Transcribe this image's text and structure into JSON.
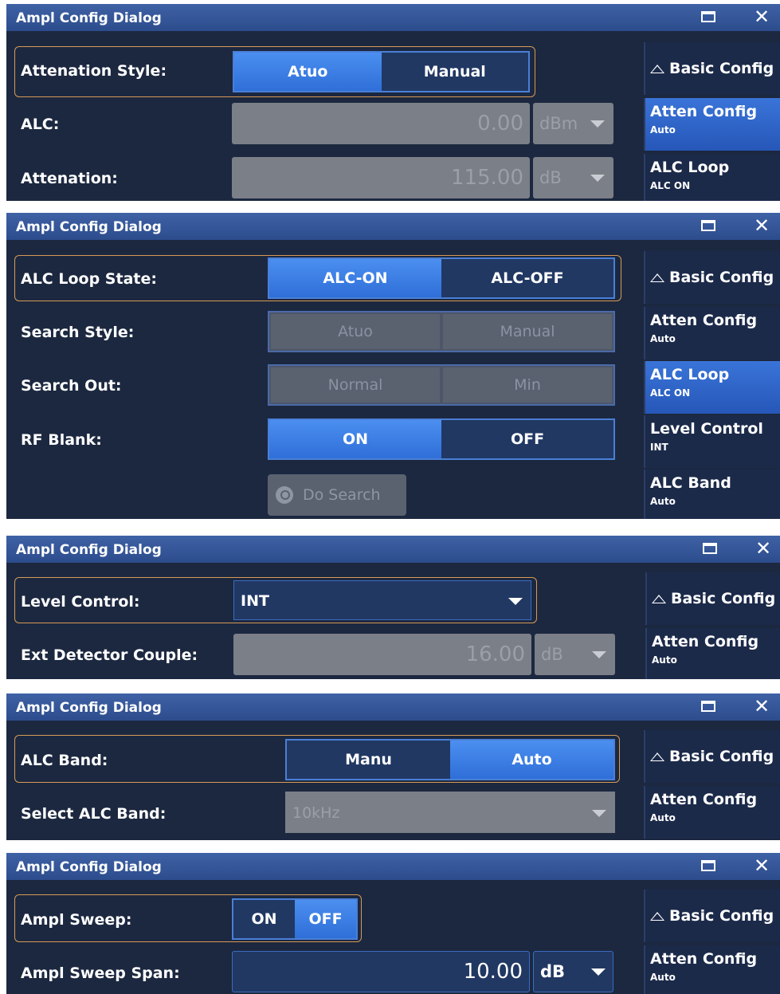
{
  "dialog_title": "Ampl Config Dialog",
  "sidebar": {
    "basic": "Basic Config",
    "atten": {
      "label": "Atten Config",
      "sub": "Auto"
    },
    "alc_loop": {
      "label": "ALC Loop",
      "sub": "ALC ON"
    },
    "level": {
      "label": "Level Control",
      "sub": "INT"
    },
    "alc_band": {
      "label": "ALC Band",
      "sub": "Auto"
    }
  },
  "p1": {
    "style_label": "Attenation Style:",
    "style_opts": [
      "Atuo",
      "Manual"
    ],
    "alc_label": "ALC:",
    "alc_value": "0.00",
    "alc_unit": "dBm",
    "atten_label": "Attenation:",
    "atten_value": "115.00",
    "atten_unit": "dB"
  },
  "p2": {
    "state_label": "ALC Loop State:",
    "state_opts": [
      "ALC-ON",
      "ALC-OFF"
    ],
    "search_label": "Search Style:",
    "search_opts": [
      "Atuo",
      "Manual"
    ],
    "out_label": "Search Out:",
    "out_opts": [
      "Normal",
      "Min"
    ],
    "rf_label": "RF Blank:",
    "rf_opts": [
      "ON",
      "OFF"
    ],
    "do_search": "Do Search"
  },
  "p3": {
    "level_label": "Level Control:",
    "level_value": "INT",
    "ext_label": "Ext Detector Couple:",
    "ext_value": "16.00",
    "ext_unit": "dB"
  },
  "p4": {
    "band_label": "ALC Band:",
    "band_opts": [
      "Manu",
      "Auto"
    ],
    "select_label": "Select ALC Band:",
    "select_value": "10kHz"
  },
  "p5": {
    "sweep_label": "Ampl Sweep:",
    "sweep_opts": [
      "ON",
      "OFF"
    ],
    "span_label": "Ampl Sweep Span:",
    "span_value": "10.00",
    "span_unit": "dB"
  }
}
